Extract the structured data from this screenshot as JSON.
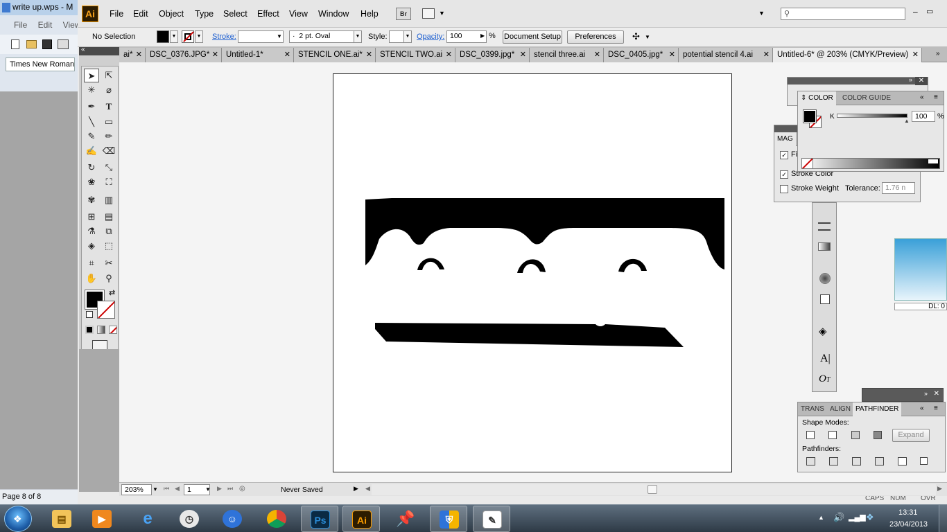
{
  "wps": {
    "title": "write up.wps - M",
    "menus": "File  Edit  View",
    "font_box": "Times New Roman",
    "status": "Page 8 of 8"
  },
  "app": {
    "logo": "Ai",
    "menus": [
      "File",
      "Edit",
      "Object",
      "Type",
      "Select",
      "Effect",
      "View",
      "Window",
      "Help"
    ],
    "bridge": "Br"
  },
  "control": {
    "selection": "No Selection",
    "stroke_label": "Stroke:",
    "brush_label": "2 pt. Oval",
    "brush_prefix": "·",
    "style_label": "Style:",
    "opacity_label": "Opacity:",
    "opacity_value": "100",
    "percent": "%",
    "doc_setup": "Document Setup",
    "preferences": "Preferences"
  },
  "tabs": [
    {
      "label": "ai*"
    },
    {
      "label": "DSC_0376.JPG*"
    },
    {
      "label": "Untitled-1*"
    },
    {
      "label": "STENCIL ONE.ai*"
    },
    {
      "label": "STENCIL TWO.ai"
    },
    {
      "label": "DSC_0399.jpg*"
    },
    {
      "label": "stencil three.ai"
    },
    {
      "label": "DSC_0405.jpg*"
    },
    {
      "label": "potential stencil 4.ai"
    },
    {
      "label": "Untitled-6* @ 203% (CMYK/Preview)"
    }
  ],
  "status": {
    "zoom": "203%",
    "page": "1",
    "saved": "Never Saved"
  },
  "color_panel": {
    "tab_color": "COLOR",
    "tab_guide": "COLOR GUIDE",
    "k_label": "K",
    "k_value": "100",
    "percent": "%"
  },
  "magic_panel": {
    "tab": "MAG",
    "fill": "Fi",
    "stroke_color": "Stroke Color",
    "stroke_weight": "Stroke Weight",
    "tolerance": "Tolerance:",
    "tolerance_value": "1.76 n"
  },
  "pathfinder": {
    "tab_trans": "TRANS",
    "tab_align": "ALIGN",
    "tab_path": "PATHFINDER",
    "shape_modes": "Shape Modes:",
    "expand": "Expand",
    "pathfinders": "Pathfinders:"
  },
  "gradient_preview": {
    "label": "DL: 0"
  },
  "behind_status": {
    "caps": "CAPS",
    "num": "NUM",
    "ovr": "OVR"
  },
  "taskbar": {
    "time": "13:31",
    "date": "23/04/2013",
    "apps": [
      "Explorer",
      "Media",
      "IE",
      "Clock",
      "Messenger",
      "Chrome",
      "Photoshop",
      "Illustrator",
      "Pin",
      "Security",
      "Notepad"
    ],
    "ps": "Ps",
    "ai": "Ai"
  },
  "colors": {
    "ai_orange": "#f79a00",
    "ps_blue": "#2a8cd8",
    "accent_blue": "#1d5fd1"
  }
}
